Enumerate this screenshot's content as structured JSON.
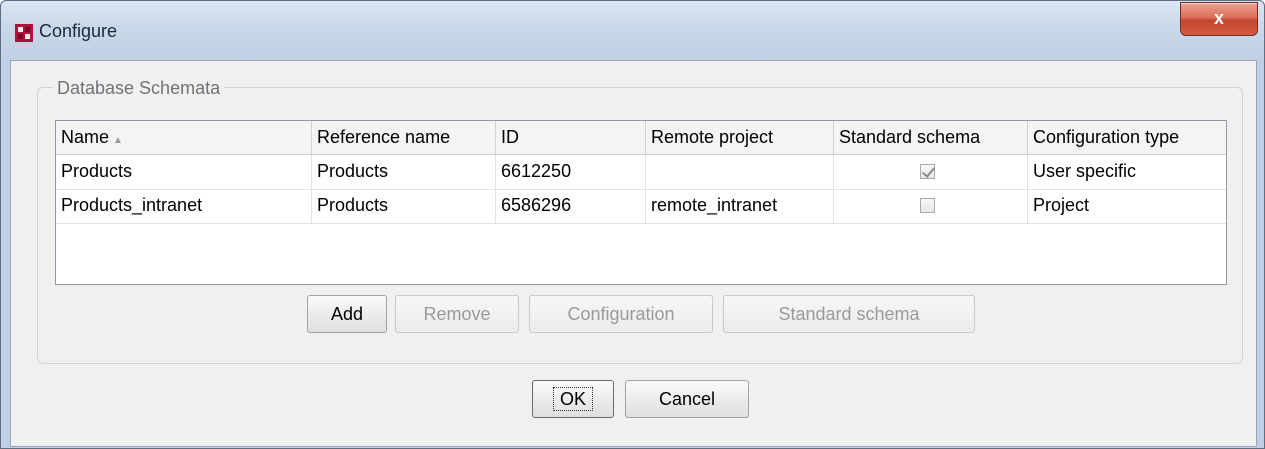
{
  "window": {
    "title": "Configure",
    "close_glyph": "x"
  },
  "group": {
    "title": "Database Schemata"
  },
  "table": {
    "columns": [
      "Name",
      "Reference name",
      "ID",
      "Remote project",
      "Standard schema",
      "Configuration type"
    ],
    "sort_indicator": "▲",
    "rows": [
      {
        "name": "Products",
        "reference_name": "Products",
        "id": "6612250",
        "remote_project": "",
        "standard_schema": true,
        "configuration_type": "User specific"
      },
      {
        "name": "Products_intranet",
        "reference_name": "Products",
        "id": "6586296",
        "remote_project": "remote_intranet",
        "standard_schema": false,
        "configuration_type": "Project"
      }
    ]
  },
  "buttons": {
    "add": "Add",
    "remove": "Remove",
    "configuration": "Configuration",
    "standard_schema": "Standard schema",
    "ok": "OK",
    "cancel": "Cancel"
  },
  "icons": {
    "app": "app-icon",
    "close": "close-icon",
    "sort": "sort-ascending-icon",
    "check": "checkmark-icon"
  },
  "colors": {
    "close_button": "#d35b40",
    "title_bar": "#c9d8ea"
  }
}
